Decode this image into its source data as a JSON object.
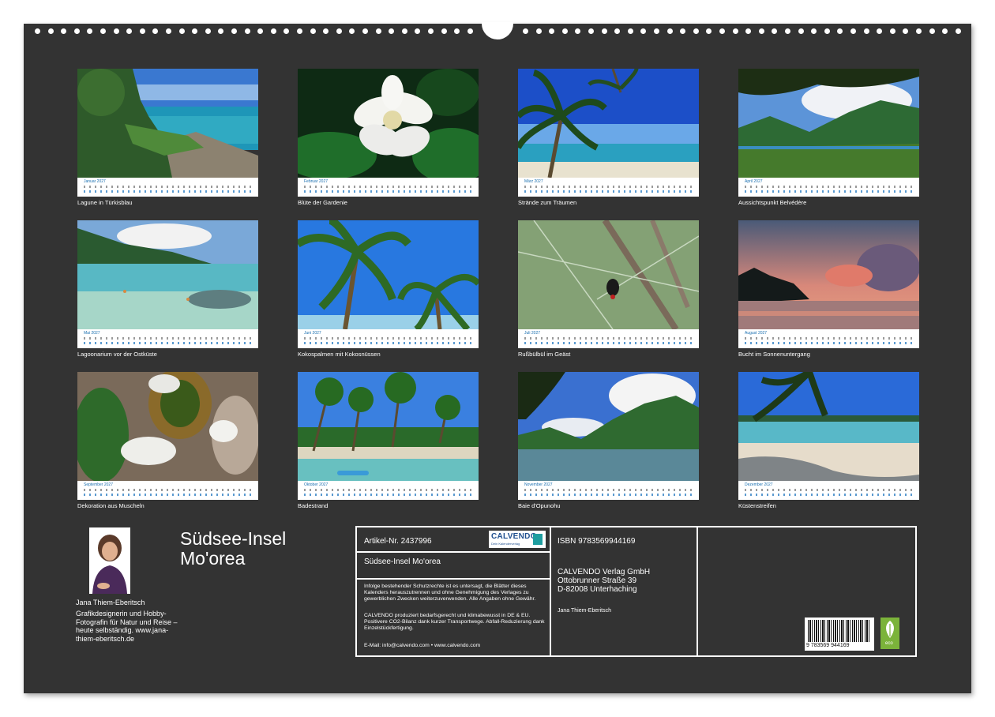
{
  "months": [
    {
      "month": "Januar 2027",
      "caption": "Lagune in Türkisblau"
    },
    {
      "month": "Februar 2027",
      "caption": "Blüte der Gardenie"
    },
    {
      "month": "März 2027",
      "caption": "Strände zum Träumen"
    },
    {
      "month": "April 2027",
      "caption": "Aussichtspunkt Belvédère"
    },
    {
      "month": "Mai 2027",
      "caption": "Lagoonarium vor der Ostküste"
    },
    {
      "month": "Juni 2027",
      "caption": "Kokospalmen mit Kokosnüssen"
    },
    {
      "month": "Juli 2027",
      "caption": "Rußbülbül im Geäst"
    },
    {
      "month": "August 2027",
      "caption": "Bucht im Sonnenuntergang"
    },
    {
      "month": "September 2027",
      "caption": "Dekoration aus Muscheln"
    },
    {
      "month": "Oktober 2027",
      "caption": "Badestrand"
    },
    {
      "month": "November 2027",
      "caption": "Baie d'Opunohu"
    },
    {
      "month": "Dezember 2027",
      "caption": "Küstenstreifen"
    }
  ],
  "author": {
    "name": "Jana Thiem-Eberitsch",
    "bio": "Grafikdesignerin und Hobby-Fotografin für Natur und Reise – heute selbständig. www.jana-thiem-eberitsch.de"
  },
  "title": {
    "line1": "Südsee-Insel",
    "line2": "Mo'orea"
  },
  "info": {
    "article": "Artikel-Nr. 2437996",
    "logo_text": "CALVENDO",
    "logo_sub": "Dein Kalenderverlag",
    "product_title": "Südsee-Insel Mo'orea",
    "legal": "Infolge bestehender Schutzrechte ist es untersagt, die Blätter dieses Kalenders herauszutrennen und ohne Genehmigung des Verlages zu gewerblichen Zwecken weiterzuverwenden. Alle Angaben ohne Gewähr.",
    "production": "CALVENDO produziert bedarfsgerecht und klimabewusst in DE & EU. Positivere CO2-Bilanz dank kurzer Transportwege. Abfall-Reduzierung dank Einzelstückfertigung.",
    "contact": "E-Mail: info@calvendo.com • www.calvendo.com",
    "isbn": "ISBN 9783569944169",
    "publisher_name": "CALVENDO Verlag GmbH",
    "publisher_street": "Ottobrunner Straße 39",
    "publisher_city": "D-82008 Unterhaching",
    "author_small": "Jana Thiem-Eberitsch",
    "barcode_digits": "9 783569 944169",
    "eco_label": "eco"
  }
}
